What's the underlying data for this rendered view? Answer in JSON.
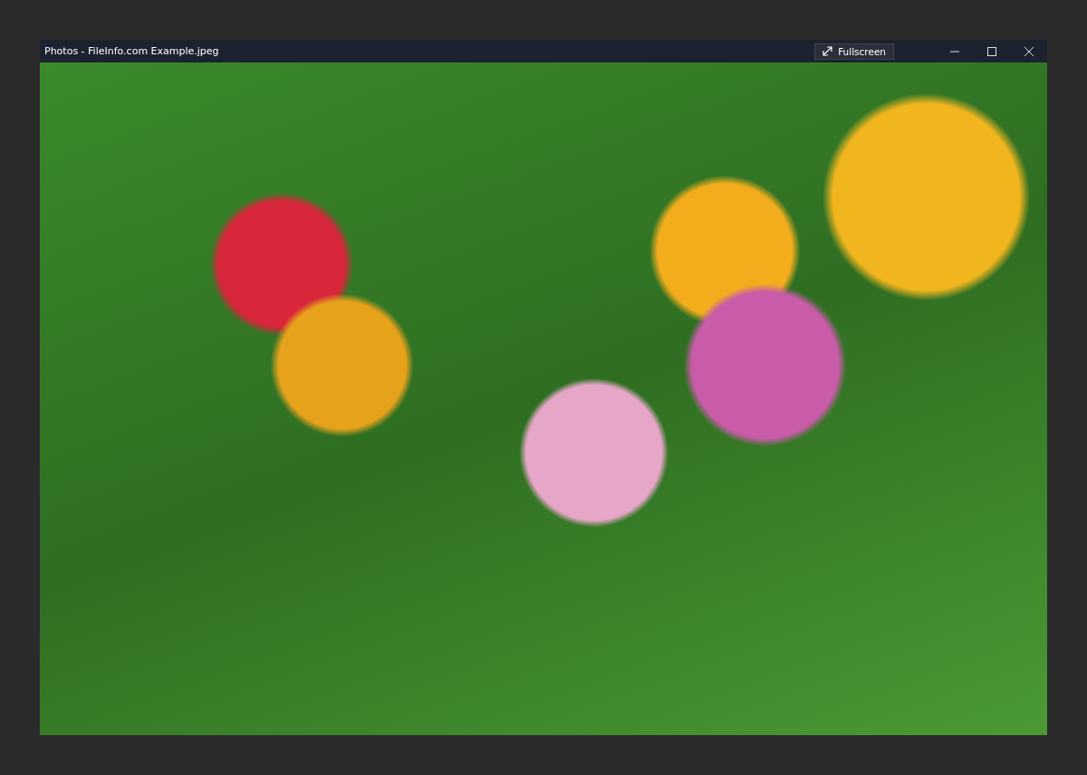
{
  "window": {
    "title": "Photos - FileInfo.com Example.jpeg"
  },
  "toolbar": {
    "fullscreen_label": "Fullscreen"
  }
}
